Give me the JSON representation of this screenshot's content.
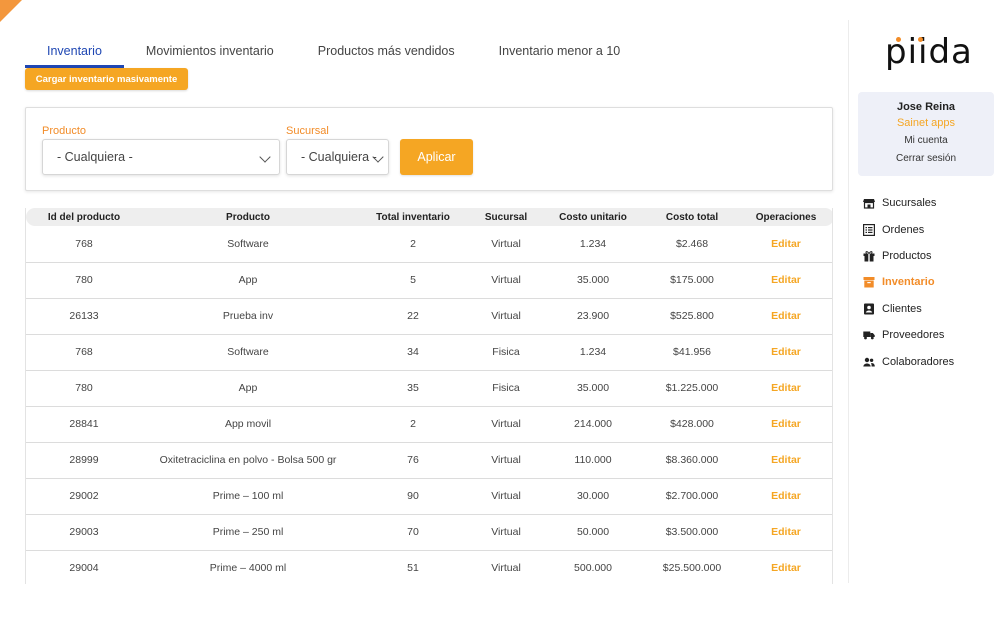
{
  "tabs": [
    {
      "label": "Inventario",
      "active": true
    },
    {
      "label": "Movimientos inventario",
      "active": false
    },
    {
      "label": "Productos más vendidos",
      "active": false
    },
    {
      "label": "Inventario menor a 10",
      "active": false
    }
  ],
  "bulk_upload_label": "Cargar inventario masivamente",
  "filters": {
    "product_label": "Producto",
    "product_value": "- Cualquiera -",
    "branch_label": "Sucursal",
    "branch_value": "- Cualquiera -",
    "apply_label": "Aplicar"
  },
  "table": {
    "headers": [
      "Id del producto",
      "Producto",
      "Total inventario",
      "Sucursal",
      "Costo unitario",
      "Costo total",
      "Operaciones"
    ],
    "rows": [
      [
        "768",
        "Software",
        "2",
        "Virtual",
        "1.234",
        "$2.468",
        "Editar"
      ],
      [
        "780",
        "App",
        "5",
        "Virtual",
        "35.000",
        "$175.000",
        "Editar"
      ],
      [
        "26133",
        "Prueba inv",
        "22",
        "Virtual",
        "23.900",
        "$525.800",
        "Editar"
      ],
      [
        "768",
        "Software",
        "34",
        "Fisica",
        "1.234",
        "$41.956",
        "Editar"
      ],
      [
        "780",
        "App",
        "35",
        "Fisica",
        "35.000",
        "$1.225.000",
        "Editar"
      ],
      [
        "28841",
        "App movil",
        "2",
        "Virtual",
        "214.000",
        "$428.000",
        "Editar"
      ],
      [
        "28999",
        "Oxitetraciclina en polvo - Bolsa 500 gr",
        "76",
        "Virtual",
        "110.000",
        "$8.360.000",
        "Editar"
      ],
      [
        "29002",
        "Prime – 100 ml",
        "90",
        "Virtual",
        "30.000",
        "$2.700.000",
        "Editar"
      ],
      [
        "29003",
        "Prime – 250 ml",
        "70",
        "Virtual",
        "50.000",
        "$3.500.000",
        "Editar"
      ],
      [
        "29004",
        "Prime – 4000 ml",
        "51",
        "Virtual",
        "500.000",
        "$25.500.000",
        "Editar"
      ]
    ]
  },
  "sidebar": {
    "logo_text": "piida",
    "user_name": "Jose Reina",
    "company": "Sainet apps",
    "account_label": "Mi cuenta",
    "logout_label": "Cerrar sesión",
    "nav": [
      {
        "label": "Sucursales",
        "icon": "store-icon",
        "active": false
      },
      {
        "label": "Ordenes",
        "icon": "list-icon",
        "active": false
      },
      {
        "label": "Productos",
        "icon": "gift-icon",
        "active": false
      },
      {
        "label": "Inventario",
        "icon": "archive-icon",
        "active": true
      },
      {
        "label": "Clientes",
        "icon": "contact-card-icon",
        "active": false
      },
      {
        "label": "Proveedores",
        "icon": "truck-icon",
        "active": false
      },
      {
        "label": "Colaboradores",
        "icon": "users-icon",
        "active": false
      }
    ]
  },
  "colors": {
    "accent": "#f5a623",
    "active_tab": "#1f47b3",
    "nav_active": "#f28c28"
  }
}
